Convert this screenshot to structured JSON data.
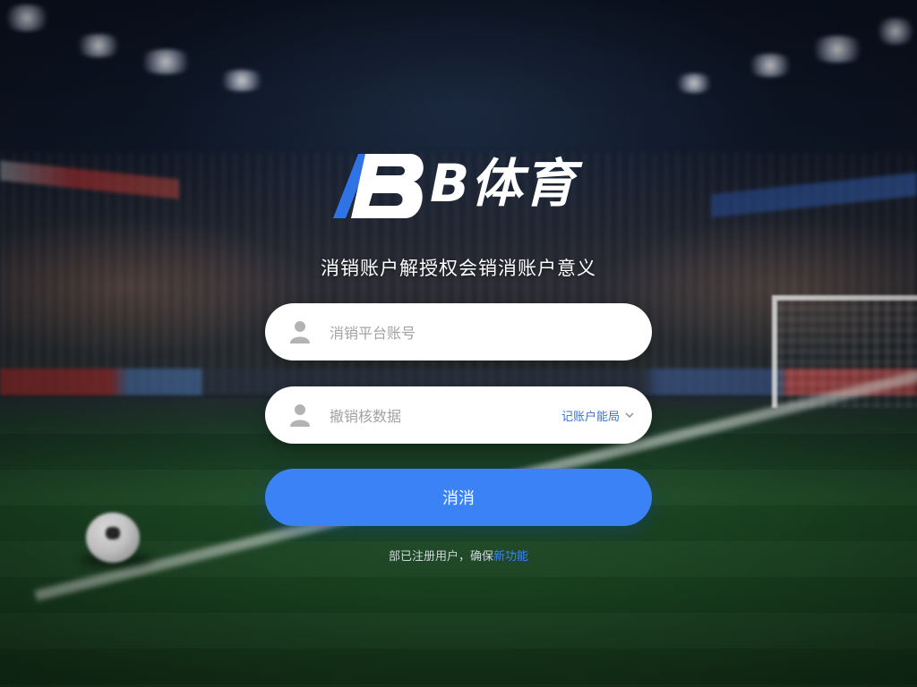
{
  "brand": {
    "logo_text": "B体育",
    "accent_color": "#2f73e6"
  },
  "header": {
    "subtitle": "消销账户解授权会销消账户意义"
  },
  "form": {
    "account_field": {
      "placeholder": "消销平台账号",
      "value": "",
      "icon": "user-icon"
    },
    "second_field": {
      "placeholder": "撤销核数据",
      "value": "",
      "icon": "user-icon",
      "dropdown_label": "记账户能局"
    },
    "submit_label": "消消",
    "submit_color": "#3b82f6"
  },
  "footer": {
    "prefix": "部已注册用户，确保",
    "link": "新功能"
  }
}
